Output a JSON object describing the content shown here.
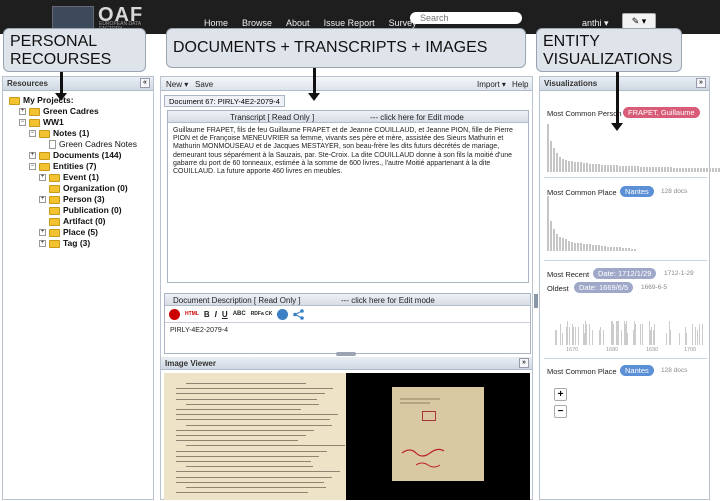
{
  "nav": {
    "logo": "OAF",
    "logo_sub": "EUROPEAN DATA FACTORY",
    "links": [
      "Home",
      "Browse",
      "About",
      "Issue Report",
      "Survey"
    ],
    "search_placeholder": "Search",
    "user": "anthi ▾",
    "edit_button": "✎ ▾"
  },
  "callouts": {
    "left": "PERSONAL\nRECOURSES",
    "middle": "DOCUMENTS + TRANSCRIPTS + IMAGES",
    "right": "ENTITY\nVISUALIZATIONS"
  },
  "resources": {
    "title": "Resources",
    "collapse": "«",
    "tree": [
      {
        "label": "My Projects:",
        "bold": true,
        "level": 0,
        "pm": "",
        "icon": "folder"
      },
      {
        "label": "Green Cadres",
        "bold": true,
        "level": 1,
        "pm": "+",
        "icon": "folder"
      },
      {
        "label": "WW1",
        "bold": true,
        "level": 1,
        "pm": "−",
        "icon": "folder"
      },
      {
        "label": "Notes (1)",
        "bold": true,
        "level": 2,
        "pm": "−",
        "icon": "folder"
      },
      {
        "label": "Green Cadres Notes",
        "bold": false,
        "level": 3,
        "pm": "",
        "icon": "doc"
      },
      {
        "label": "Documents (144)",
        "bold": true,
        "level": 2,
        "pm": "+",
        "icon": "folder"
      },
      {
        "label": "Entities (7)",
        "bold": true,
        "level": 2,
        "pm": "−",
        "icon": "folder"
      },
      {
        "label": "Event (1)",
        "bold": true,
        "level": 3,
        "pm": "+",
        "icon": "folder"
      },
      {
        "label": "Organization (0)",
        "bold": true,
        "level": 3,
        "pm": "",
        "icon": "folder"
      },
      {
        "label": "Person (3)",
        "bold": true,
        "level": 3,
        "pm": "+",
        "icon": "folder"
      },
      {
        "label": "Publication (0)",
        "bold": true,
        "level": 3,
        "pm": "",
        "icon": "folder"
      },
      {
        "label": "Artifact (0)",
        "bold": true,
        "level": 3,
        "pm": "",
        "icon": "folder"
      },
      {
        "label": "Place (5)",
        "bold": true,
        "level": 3,
        "pm": "+",
        "icon": "folder"
      },
      {
        "label": "Tag (3)",
        "bold": true,
        "level": 3,
        "pm": "+",
        "icon": "folder"
      }
    ]
  },
  "documents": {
    "toolbar": {
      "new": "New ▾",
      "save": "Save",
      "import": "Import ▾",
      "help": "Help"
    },
    "doc_tab": "Document 67: PIRLY-4E2-2079-4",
    "transcript_bar": "Transcript  [ Read Only ]",
    "transcript_edit": "--- click here for Edit mode",
    "transcript_text": "Guillaume FRAPET, fils de feu Guillaume FRAPET et de Jeanne COUILLAUD, et Jeanne PION, fille de Pierre PION et de Françoise MENEUVRIER sa femme, vivants ses père et mère, assistée des Sieurs Mathurin et Mathurin MONMOUSEAU et de Jacques MESTAYER, son beau-frère les dits futurs décrétés de mariage, demeurant tous séparément à la Sauzais, par. Ste-Croix. La dite COUILLAUD donne à son fils la moitié d'une gabarre du port de 60 tonneaux, estimée à la somme de 600 livres., l'autre Moitié appartenant à la dite COUILLAUD. La future apporte 460 livres en meubles.",
    "desc_bar": "Document Description  [ Read Only ]",
    "desc_edit": "--- click here for Edit mode",
    "editor_tools": [
      "HTML",
      "B",
      "I",
      "U",
      "ABC",
      "RDFa CK"
    ],
    "desc_value": "PIRLY-4E2-2079-4",
    "image_viewer_title": "Image Viewer",
    "image_viewer_btn": "»"
  },
  "visualizations": {
    "title": "Visualizations",
    "collapse": "»",
    "person_label": "Most Common Person",
    "person_value": "FRAPET, Guillaume",
    "place_label": "Most Common Place",
    "place_value": "Nantes",
    "place_docs": "128 docs",
    "recent_label": "Most Recent",
    "recent_value": "Date: 1712/1/29",
    "recent_plain": "1712-1-29",
    "oldest_label": "Oldest",
    "oldest_value": "Date: 1669/6/5",
    "oldest_plain": "1669-6-5",
    "timeline_ticks": [
      "1670",
      "1680",
      "1690",
      "1700"
    ],
    "place2_label": "Most Common Place",
    "place2_value": "Nantes",
    "place2_docs": "128 docs",
    "zoom_in": "+",
    "zoom_out": "−",
    "colors": {
      "person": "#d85c78",
      "place": "#5b8fd6",
      "date": "#9fa8c9"
    },
    "person_histogram": [
      0.95,
      0.62,
      0.48,
      0.38,
      0.3,
      0.26,
      0.24,
      0.22,
      0.22,
      0.2,
      0.2,
      0.19,
      0.18,
      0.17,
      0.16,
      0.16,
      0.15,
      0.15,
      0.14,
      0.14,
      0.14,
      0.13,
      0.13,
      0.13,
      0.12,
      0.12,
      0.12,
      0.11,
      0.11,
      0.11,
      0.11,
      0.1,
      0.1,
      0.1,
      0.1,
      0.1,
      0.09,
      0.09,
      0.09,
      0.09,
      0.09,
      0.09,
      0.08,
      0.08,
      0.08,
      0.08,
      0.08,
      0.08,
      0.08,
      0.07,
      0.07,
      0.07,
      0.07,
      0.07,
      0.07,
      0.07,
      0.07,
      0.07,
      0.06,
      0.06,
      0.06,
      0.06
    ],
    "place_histogram": [
      1.0,
      0.55,
      0.4,
      0.3,
      0.26,
      0.24,
      0.22,
      0.18,
      0.17,
      0.15,
      0.15,
      0.14,
      0.13,
      0.12,
      0.12,
      0.11,
      0.1,
      0.1,
      0.09,
      0.09,
      0.08,
      0.08,
      0.08,
      0.07,
      0.07,
      0.06,
      0.05,
      0.05,
      0.04,
      0.04
    ]
  }
}
